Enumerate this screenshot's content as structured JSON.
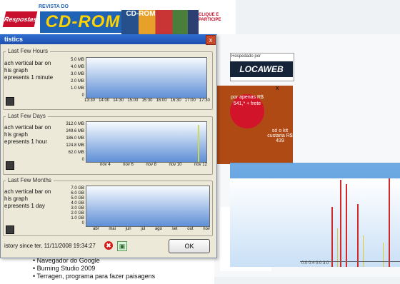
{
  "magazine": {
    "brand_small": "REVISTA DO",
    "title": "CD-ROM",
    "logo_text": "Respostas",
    "cover_label": "CD-ROM",
    "cta": "CLIQUE E PARTICIPE"
  },
  "ads": {
    "locaweb_caption": "Hospedado por",
    "locaweb_logo": "LOCAWEB",
    "promo_circle": "por apenas R$ 541,* + frete",
    "promo_text": "só o kit custaria R$ 439",
    "close": "x"
  },
  "bottom_list": [
    "Navegador do Google",
    "Burning Studio 2009",
    "Terragen, programa para fazer paisagens"
  ],
  "stats_window": {
    "title": "tistics",
    "close": "x",
    "sections": [
      {
        "title": "Last Few Hours",
        "description": [
          "ach vertical bar on",
          "his graph",
          "epresents 1 minute"
        ],
        "y_labels": [
          "5.0 MB",
          "4.0 MB",
          "3.0 MB",
          "2.0 MB",
          "1.0 MB",
          "0"
        ],
        "x_labels": [
          "13:30",
          "14:00",
          "14:30",
          "15:00",
          "15:30",
          "16:00",
          "16:30",
          "17:00",
          "17:30"
        ]
      },
      {
        "title": "Last Few Days",
        "description": [
          "ach vertical bar on",
          "his graph",
          "epresents 1 hour"
        ],
        "y_labels": [
          "312.0 MB",
          "249.6 MB",
          "186.0 MB",
          "124.8 MB",
          "62.0 MB",
          "0"
        ],
        "x_labels": [
          "nov 4",
          "nov 6",
          "nov 8",
          "nov 10",
          "nov 12"
        ]
      },
      {
        "title": "Last Few Months",
        "description": [
          "ach vertical bar on",
          "his graph",
          "epresents 1 day"
        ],
        "y_labels": [
          "7.0 GB",
          "6.0 GB",
          "5.0 GB",
          "4.0 GB",
          "3.0 GB",
          "2.0 GB",
          "1.0 GB",
          "0"
        ],
        "x_labels": [
          "abr",
          "mai",
          "jun",
          "jul",
          "ago",
          "set",
          "out",
          "nov"
        ]
      }
    ],
    "history": "istory since ter, 11/11/2008 19:34:27",
    "delete_icon": "✖",
    "snapshot_icon": "▣",
    "ok_label": "OK"
  },
  "graph_window": {
    "readout": "0.0 0.4 0.0 3.0"
  },
  "colors": {
    "titlebar": "#2f6fd0",
    "plot_fill": "#5f8fd6",
    "spike": "#d12a2a",
    "magazine_blue": "#1f63b6",
    "magazine_yellow": "#ffd200"
  }
}
